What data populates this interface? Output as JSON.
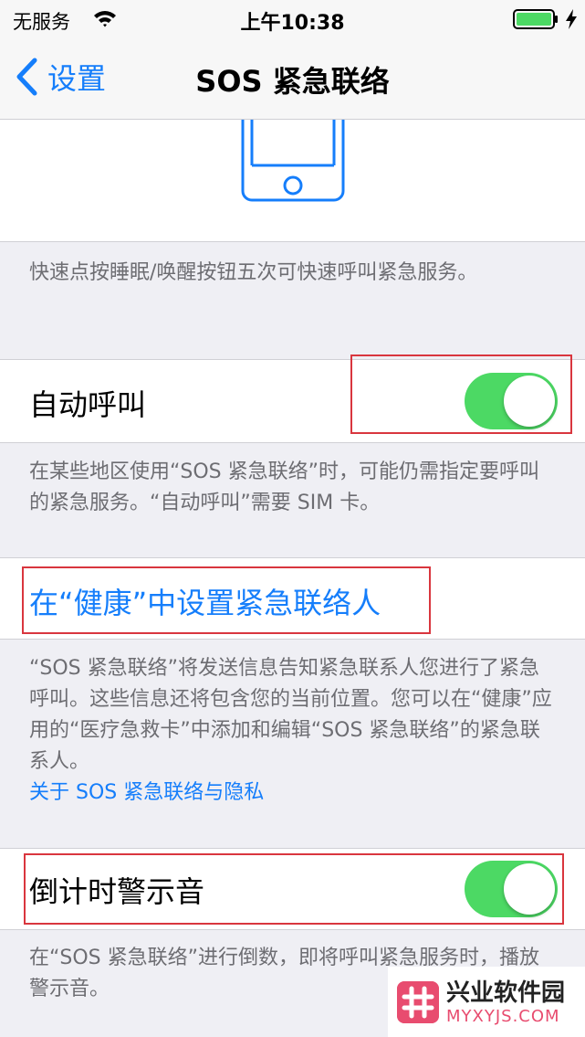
{
  "status_bar": {
    "carrier": "无服务",
    "time": "上午10:38"
  },
  "nav": {
    "back_label": "设置",
    "title": "SOS 紧急联络"
  },
  "sections": {
    "intro_footer": "快速点按睡眠/唤醒按钮五次可快速呼叫紧急服务。",
    "auto_call": {
      "label": "自动呼叫",
      "on": true,
      "footer": "在某些地区使用“SOS 紧急联络”时，可能仍需指定要呼叫的紧急服务。“自动呼叫”需要 SIM 卡。"
    },
    "health_contacts": {
      "label": "在“健康”中设置紧急联络人",
      "footer": "“SOS 紧急联络”将发送信息告知紧急联系人您进行了紧急呼叫。这些信息还将包含您的当前位置。您可以在“健康”应用的“医疗急救卡”中添加和编辑“SOS 紧急联络”的紧急联系人。",
      "privacy_link": "关于 SOS 紧急联络与隐私"
    },
    "countdown_sound": {
      "label": "倒计时警示音",
      "on": true,
      "footer": "在“SOS 紧急联络”进行倒数，即将呼叫紧急服务时，播放警示音。"
    }
  },
  "watermark": {
    "title": "兴业软件园",
    "url": "MYXYJS.COM"
  },
  "colors": {
    "accent": "#157efb",
    "toggle_on": "#4cd964",
    "highlight": "#d9363e"
  }
}
